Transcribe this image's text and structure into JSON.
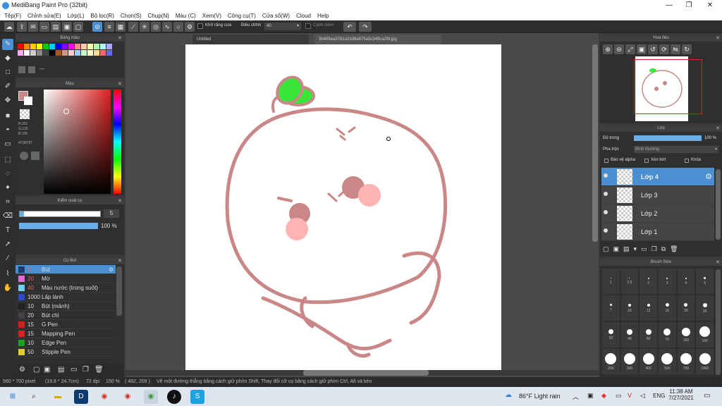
{
  "window": {
    "title": "MediBang Paint Pro (32bit)"
  },
  "menu": [
    "Tệp(F)",
    "Chỉnh sửa(E)",
    "Lớp(L)",
    "Bộ lọc(R)",
    "Chọn(S)",
    "Chụp(N)",
    "Màu (C)",
    "Xem(V)",
    "Công cụ(T)",
    "Cửa sổ(W)",
    "Cloud",
    "Help"
  ],
  "toolbar": {
    "antialias_label": "Khử răng cưa",
    "adjust_label": "Điều chỉnh",
    "adjust_value": "40",
    "snap_label": "Cạnh mềm"
  },
  "panels": {
    "palette": {
      "title": "Bảng màu",
      "name": "---"
    },
    "color": {
      "title": "Màu",
      "r": "R:201",
      "g": "G:135",
      "b": "B:135",
      "hex": "#C98787"
    },
    "brush_control": {
      "title": "Kiểm soát cọ",
      "size": "5",
      "opacity": "100 %"
    },
    "brushes": {
      "title": "Cọ Bút",
      "items": [
        {
          "size": "5",
          "name": "Bút",
          "color": "#1e3a6e",
          "selected": true
        },
        {
          "size": "20",
          "name": "Mờ",
          "color": "#e26ad6"
        },
        {
          "size": "40",
          "name": "Màu nước (trong suốt)",
          "color": "#6fd0f0"
        },
        {
          "size": "1000",
          "name": "Lấp lánh",
          "color": "#2a4ad0"
        },
        {
          "size": "10",
          "name": "Bút (mảnh)",
          "color": "#222222"
        },
        {
          "size": "20",
          "name": "Bút chì",
          "color": "#444444"
        },
        {
          "size": "15",
          "name": "G Pen",
          "color": "#d02020"
        },
        {
          "size": "15",
          "name": "Mapping Pen",
          "color": "#e02020"
        },
        {
          "size": "10",
          "name": "Edge Pen",
          "color": "#20a020"
        },
        {
          "size": "50",
          "name": "Stipple Pen",
          "color": "#e0d020"
        }
      ]
    }
  },
  "tabs": {
    "untitled": "Untitled",
    "file": "3b469aa3761a33d9a675a5c349ca2fd.jpg"
  },
  "navigator": {
    "title": "Hoa tiêu"
  },
  "layers": {
    "title": "Lớp",
    "opacity_label": "Độ trong",
    "opacity_value": "100 %",
    "blend_label": "Pha trộn",
    "blend_value": "Bình thường",
    "protect_alpha": "Bảo vệ alpha",
    "clipping": "Xén bớt",
    "lock": "Khóa",
    "items": [
      {
        "name": "Lớp 4",
        "selected": true
      },
      {
        "name": "Lớp 3"
      },
      {
        "name": "Lớp 2"
      },
      {
        "name": "Lớp 1"
      }
    ]
  },
  "brush_size": {
    "title": "Brush Size",
    "sizes": [
      "1",
      "1.5",
      "2",
      "3",
      "4",
      "5",
      "7",
      "10",
      "12",
      "15",
      "20",
      "25",
      "30",
      "40",
      "50",
      "70",
      "100",
      "150",
      "200",
      "300",
      "400",
      "500",
      "700",
      "1000"
    ]
  },
  "status": {
    "dims": "560 * 700 pixel",
    "physical": "(19.8 * 24.7cm)",
    "dpi": "72 dpi",
    "zoom": "150 %",
    "coords": "( 482, 209 )",
    "hint": "Vẽ một đường thẳng bằng cách giữ phím Shift, Thay đổi cỡ cọ bằng cách giữ phím Ctrl, Alt và kéo"
  },
  "taskbar": {
    "weather": "86°F  Light rain",
    "lang": "ENG",
    "time": "11:38 AM",
    "date": "7/27/2021"
  },
  "colors": {
    "stroke": "#c98787",
    "accent": "#4a8fd0",
    "leaf": "#39e639"
  }
}
